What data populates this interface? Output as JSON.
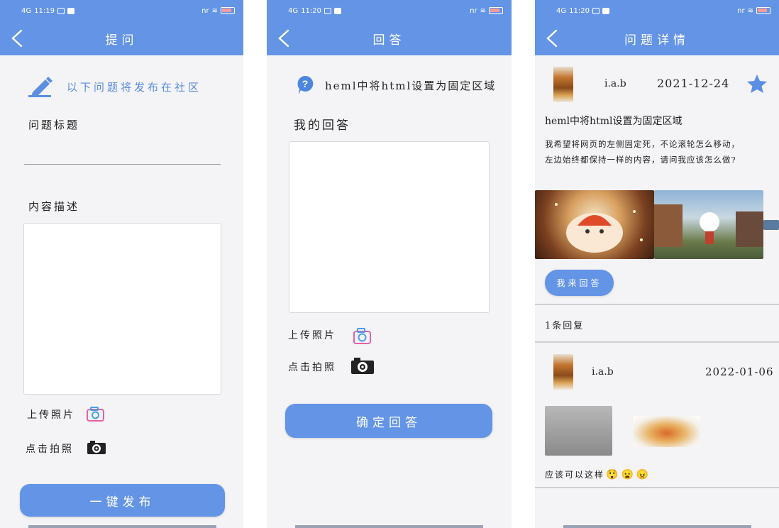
{
  "screen_ask": {
    "status": {
      "signal": "4G",
      "time": "11:19",
      "right": "nr"
    },
    "title": "提问",
    "notice": "以下问题将发布在社区",
    "question_title_label": "问题标题",
    "content_label": "内容描述",
    "upload_label": "上传照片",
    "photo_label": "点击拍照",
    "publish_button": "一键发布"
  },
  "screen_answer": {
    "status": {
      "signal": "4G",
      "time": "11:20",
      "right": "nr"
    },
    "title": "回答",
    "question_text": "heml中将html设置为固定区域",
    "my_answer_label": "我的回答",
    "upload_label": "上传照片",
    "photo_label": "点击拍照",
    "confirm_button": "确定回答"
  },
  "screen_detail": {
    "status": {
      "signal": "4G",
      "time": "11:20",
      "right": "nr"
    },
    "title": "问题详情",
    "asker": "i.a.b",
    "date": "2021-12-24",
    "question_title": "heml中将html设置为固定区域",
    "question_body_1": "我希望将网页的左侧固定死，不论滚轮怎么移动，",
    "question_body_2": "左边始终都保持一样的内容，请问我应该怎么做?",
    "answer_button": "我来回答",
    "reply_count": "1条回复",
    "reply_user": "i.a.b",
    "reply_date": "2022-01-06",
    "reply_text": "应该可以这样",
    "emojis": [
      "😲",
      "😦",
      "😠"
    ]
  },
  "colors": {
    "primary": "#6394e5",
    "background": "#f4f4f6",
    "pink": "#e75fa8"
  },
  "icons": [
    "back-arrow-icon",
    "pencil-icon",
    "question-mark-icon",
    "camera-outline-icon",
    "camera-icon",
    "star-icon"
  ]
}
